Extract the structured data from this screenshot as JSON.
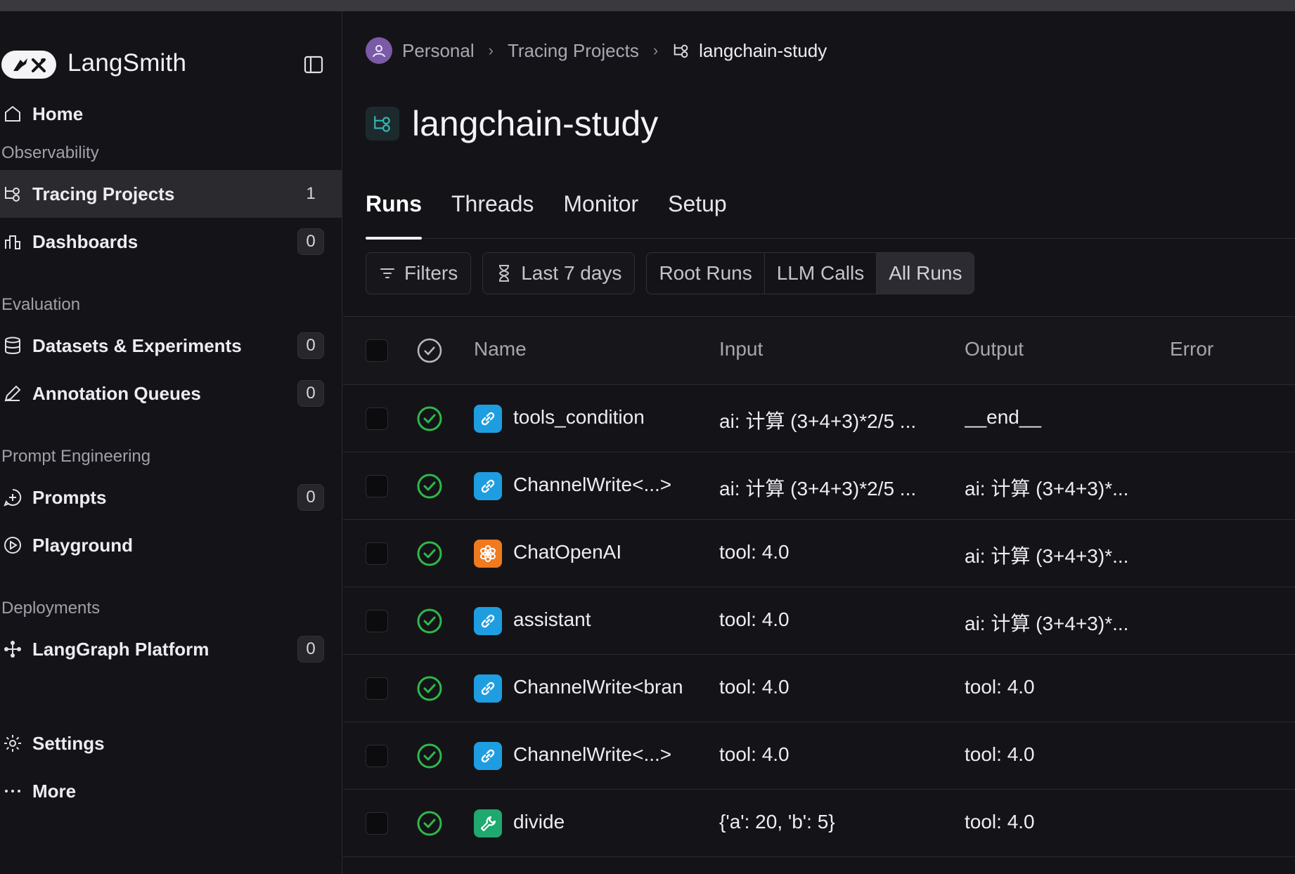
{
  "app": {
    "name": "LangSmith"
  },
  "sidebar": {
    "items": [
      {
        "label": "Home",
        "icon": "home-icon"
      },
      {
        "section": "Observability"
      },
      {
        "label": "Tracing Projects",
        "count": "1",
        "active": true,
        "icon": "tracing-icon"
      },
      {
        "label": "Dashboards",
        "count": "0",
        "icon": "dashboard-icon"
      },
      {
        "section": "Evaluation"
      },
      {
        "label": "Datasets & Experiments",
        "count": "0",
        "icon": "database-icon"
      },
      {
        "label": "Annotation Queues",
        "count": "0",
        "icon": "pencil-icon"
      },
      {
        "section": "Prompt Engineering"
      },
      {
        "label": "Prompts",
        "count": "0",
        "icon": "prompt-icon"
      },
      {
        "label": "Playground",
        "icon": "play-icon"
      },
      {
        "section": "Deployments"
      },
      {
        "label": "LangGraph Platform",
        "count": "0",
        "icon": "graph-icon"
      },
      {
        "label": "Settings",
        "icon": "gear-icon"
      },
      {
        "label": "More",
        "icon": "more-icon"
      }
    ]
  },
  "breadcrumb": {
    "personal": "Personal",
    "projects": "Tracing Projects",
    "current": "langchain-study"
  },
  "page": {
    "title": "langchain-study"
  },
  "tabs": [
    "Runs",
    "Threads",
    "Monitor",
    "Setup"
  ],
  "toolbar": {
    "filters": "Filters",
    "date_range": "Last 7 days",
    "segments": [
      "Root Runs",
      "LLM Calls",
      "All Runs"
    ]
  },
  "table": {
    "columns": {
      "name": "Name",
      "input": "Input",
      "output": "Output",
      "error": "Error"
    },
    "rows": [
      {
        "name": "tools_condition",
        "input": "ai: 计算 (3+4+3)*2/5 ...",
        "output": "__end__",
        "type": "chain"
      },
      {
        "name": "ChannelWrite<...>",
        "input": "ai: 计算 (3+4+3)*2/5 ...",
        "output": "ai: 计算 (3+4+3)*...",
        "type": "chain"
      },
      {
        "name": "ChatOpenAI",
        "input": "tool: 4.0",
        "output": "ai: 计算 (3+4+3)*...",
        "type": "llm"
      },
      {
        "name": "assistant",
        "input": "tool: 4.0",
        "output": "ai: 计算 (3+4+3)*...",
        "type": "chain"
      },
      {
        "name": "ChannelWrite<bran",
        "input": "tool: 4.0",
        "output": "tool: 4.0",
        "type": "chain"
      },
      {
        "name": "ChannelWrite<...>",
        "input": "tool: 4.0",
        "output": "tool: 4.0",
        "type": "chain"
      },
      {
        "name": "divide",
        "input": "{'a': 20, 'b': 5}",
        "output": "tool: 4.0",
        "type": "tool"
      }
    ]
  },
  "colors": {
    "chain": "#1e9ee0",
    "llm": "#f07a1e",
    "tool": "#1fa870",
    "success": "#2fb84a"
  }
}
